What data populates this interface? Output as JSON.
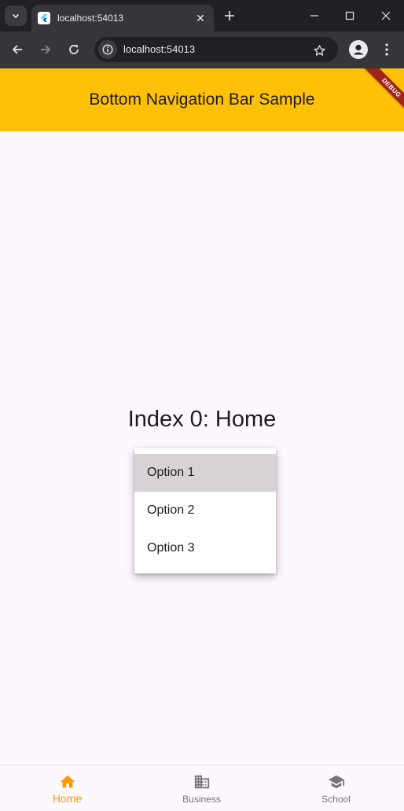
{
  "browser": {
    "tab_title": "localhost:54013",
    "url": "localhost:54013"
  },
  "app": {
    "title": "Bottom Navigation Bar Sample",
    "debug_banner": "DEBUG",
    "headline": "Index 0: Home"
  },
  "popup_menu": {
    "options": [
      {
        "label": "Option 1",
        "highlighted": true
      },
      {
        "label": "Option 2",
        "highlighted": false
      },
      {
        "label": "Option 3",
        "highlighted": false
      }
    ]
  },
  "bottom_nav": {
    "selected_index": 0,
    "items": [
      {
        "label": "Home",
        "icon": "home-icon"
      },
      {
        "label": "Business",
        "icon": "business-icon"
      },
      {
        "label": "School",
        "icon": "school-icon"
      }
    ]
  },
  "colors": {
    "app_bar": "#ffc107",
    "selected_item": "#ff9800",
    "unselected_item": "#757575",
    "background": "#fdf7fe",
    "debug_ribbon": "#a0241b"
  }
}
